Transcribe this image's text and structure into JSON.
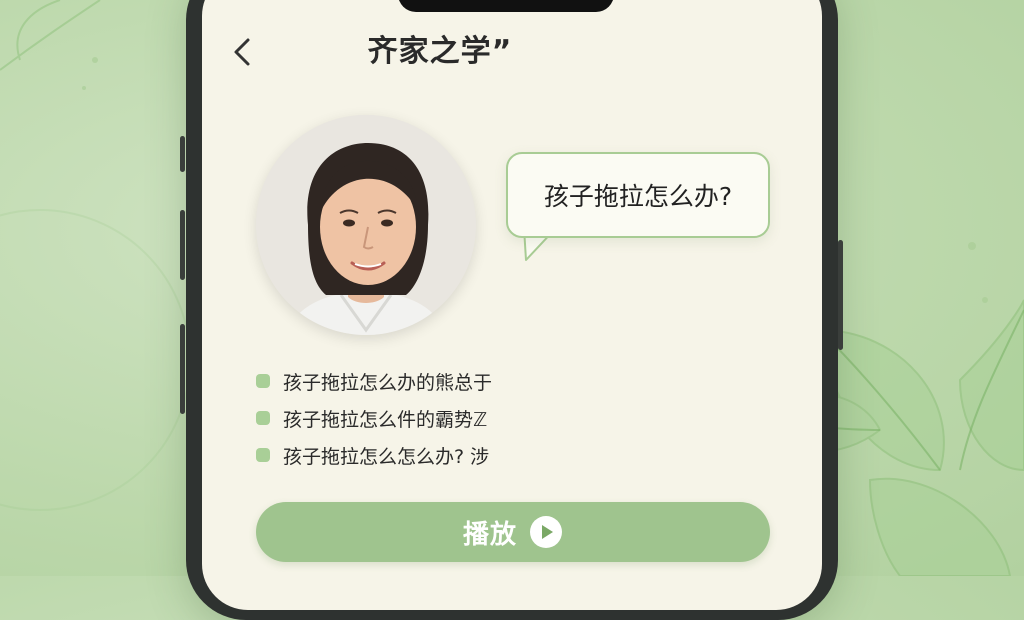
{
  "header": {
    "back_icon": "chevron-left-icon",
    "title": "齐家之学”"
  },
  "expert": {
    "avatar_icon": "woman-portrait"
  },
  "bubble": {
    "question": "孩子拖拉怎么办?"
  },
  "topics": [
    {
      "label": "孩子拖拉怎么办的熊总于"
    },
    {
      "label": "孩子拖拉怎么件的霸势ℤ"
    },
    {
      "label": "孩子拖拉怎么怎么办? 涉"
    }
  ],
  "player": {
    "label": "播放",
    "icon": "play-circle-icon"
  },
  "colors": {
    "accent": "#9fc48e",
    "bullet": "#a9cf97",
    "screen_bg": "#f6f4e8",
    "page_bg": "#bcd8ab"
  }
}
